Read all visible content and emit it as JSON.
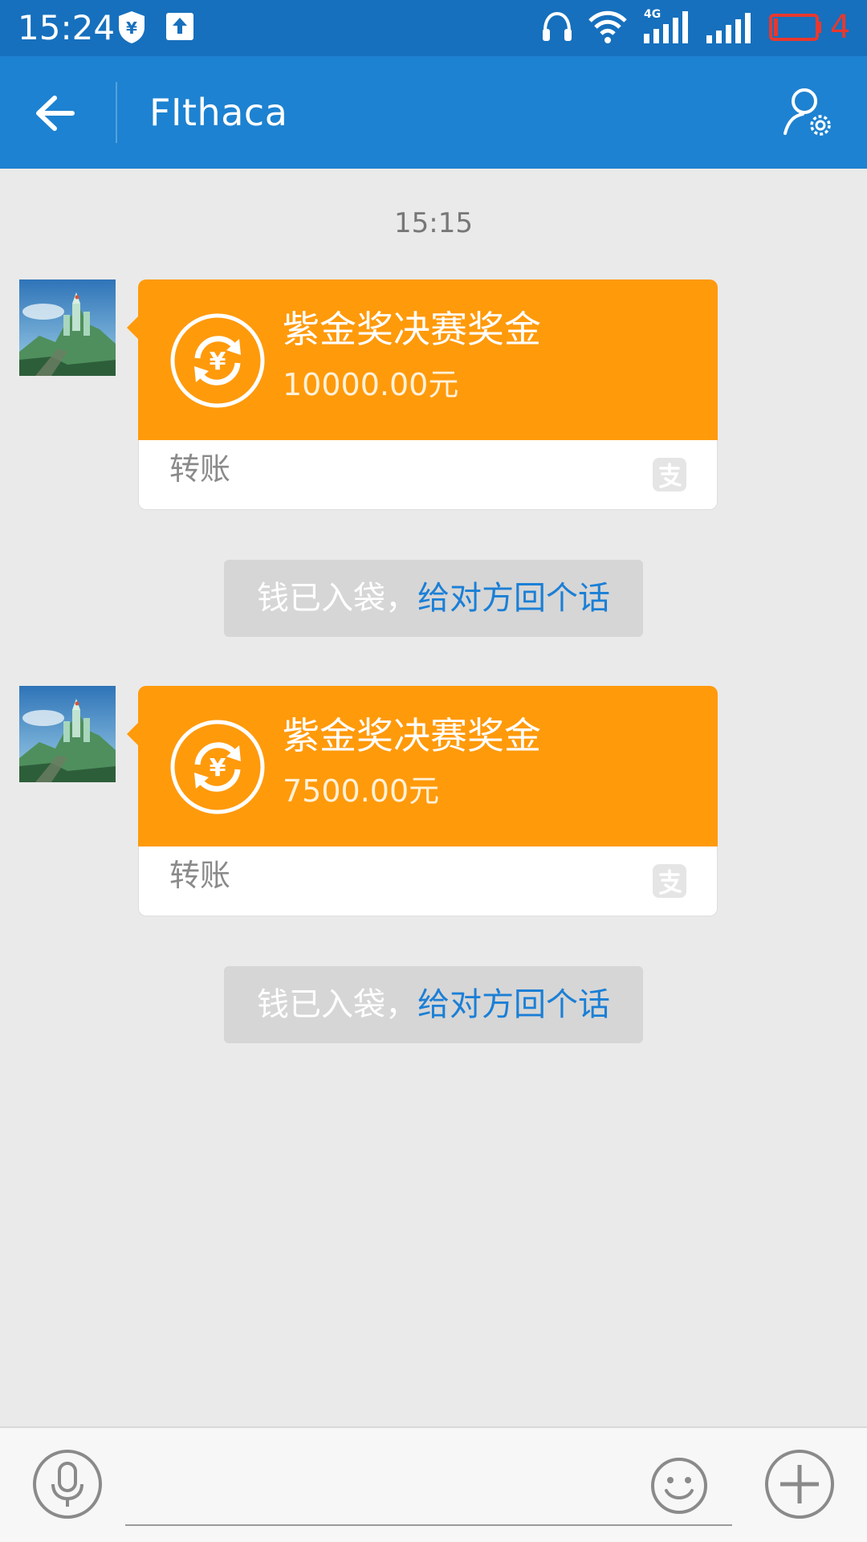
{
  "status_bar": {
    "time": "15:24",
    "network_label": "4G",
    "battery_level": "4",
    "battery_color": "#e8382e",
    "icons": [
      "shield-yen-icon",
      "upload-icon",
      "headset-icon",
      "wifi-icon",
      "4g-signal-icon",
      "signal-icon",
      "battery-icon"
    ]
  },
  "header": {
    "title": "FIthaca",
    "back_icon": "arrow-left-icon",
    "settings_icon": "profile-settings-icon",
    "background_color": "#1d82d1"
  },
  "chat": {
    "timestamp": "15:15",
    "messages": [
      {
        "title": "紫金奖决赛奖金",
        "amount": "10000.00元",
        "type": "转账",
        "notice_prefix": "钱已入袋，",
        "notice_link": "给对方回个话"
      },
      {
        "title": "紫金奖决赛奖金",
        "amount": "7500.00元",
        "type": "转账",
        "notice_prefix": "钱已入袋，",
        "notice_link": "给对方回个话"
      }
    ],
    "card_color": "#ff9a0b",
    "link_color": "#1b7fd6"
  },
  "input_bar": {
    "message_value": "",
    "icons": [
      "microphone-icon",
      "emoji-icon",
      "plus-icon"
    ]
  }
}
